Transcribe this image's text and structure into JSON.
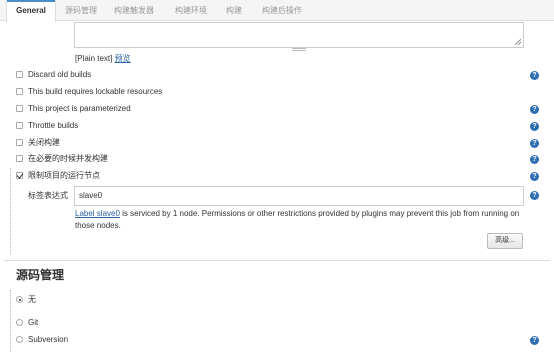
{
  "tabs": [
    {
      "label": "General"
    },
    {
      "label": "源码管理"
    },
    {
      "label": "构建触发器"
    },
    {
      "label": "构建环境"
    },
    {
      "label": "构建"
    },
    {
      "label": "构建后操作"
    }
  ],
  "description": {
    "plain_text": "[Plain text]",
    "preview_link": "预览"
  },
  "options": [
    {
      "label": "Discard old builds",
      "checked": false
    },
    {
      "label": "This build requires lockable resources",
      "checked": false
    },
    {
      "label": "This project is parameterized",
      "checked": false
    },
    {
      "label": "Throttle builds",
      "checked": false
    },
    {
      "label": "关闭构建",
      "checked": false
    },
    {
      "label": "在必要的时候并发构建",
      "checked": false
    },
    {
      "label": "限制项目的运行节点",
      "checked": true
    }
  ],
  "label_expression": {
    "label": "标签表达式",
    "value": "slave0",
    "link": "Label slave0",
    "info": " is serviced by 1 node. Permissions or other restrictions provided by plugins may prevent this job from running on those nodes."
  },
  "advanced_button": "高级...",
  "scm": {
    "title": "源码管理",
    "options": [
      {
        "label": "无",
        "selected": true
      },
      {
        "label": "Git",
        "selected": false
      },
      {
        "label": "Subversion",
        "selected": false
      }
    ]
  },
  "help_glyph": "?",
  "colors": {
    "link": "#2a62a6",
    "help": "#2d6db4",
    "tab_accent": "#4a90c8"
  }
}
